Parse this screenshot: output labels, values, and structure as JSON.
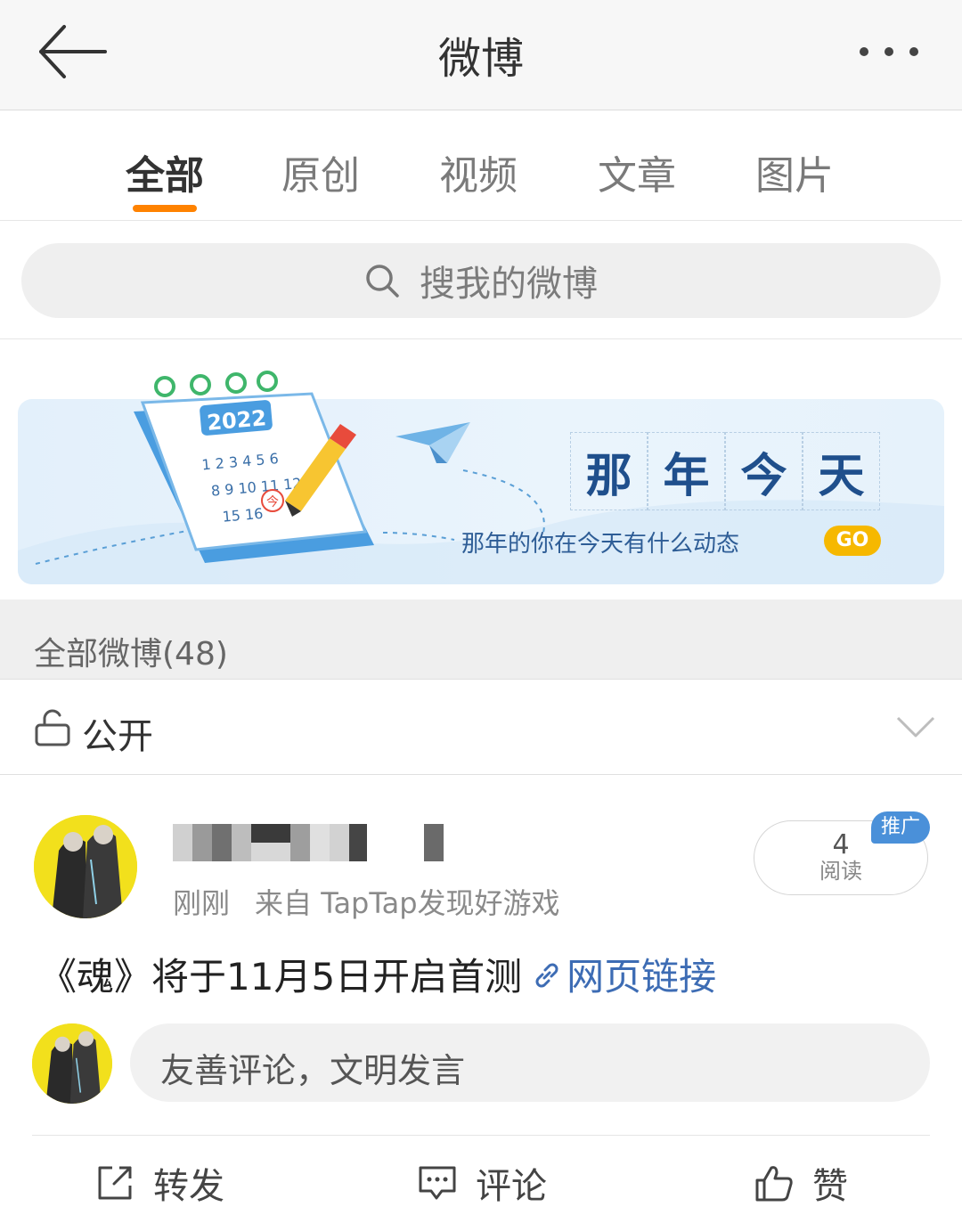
{
  "header": {
    "title": "微博",
    "back_icon": "back-arrow-icon",
    "more_icon": "more-dots-icon"
  },
  "tabs": [
    {
      "label": "全部",
      "active": true
    },
    {
      "label": "原创",
      "active": false
    },
    {
      "label": "视频",
      "active": false
    },
    {
      "label": "文章",
      "active": false
    },
    {
      "label": "图片",
      "active": false
    }
  ],
  "search": {
    "placeholder": "搜我的微博"
  },
  "banner": {
    "calendar_year": "2022",
    "calendar_today": "今",
    "title_chars": [
      "那",
      "年",
      "今",
      "天"
    ],
    "subtitle": "那年的你在今天有什么动态",
    "go_label": "GO"
  },
  "section": {
    "label": "全部微博(48)"
  },
  "filter": {
    "label": "公开"
  },
  "post": {
    "time": "刚刚",
    "source": "来自 TapTap发现好游戏",
    "read_count": "4",
    "read_label": "阅读",
    "promo_label": "推广",
    "text": "《魂》将于11月5日开启首测",
    "link_label": "网页链接",
    "comment_placeholder": "友善评论，文明发言"
  },
  "actions": {
    "repost": "转发",
    "comment": "评论",
    "like": "赞"
  },
  "colors": {
    "accent": "#ff8200",
    "link": "#3d6cb4",
    "go_button": "#f6b800",
    "promo_tag": "#4a90d9"
  }
}
